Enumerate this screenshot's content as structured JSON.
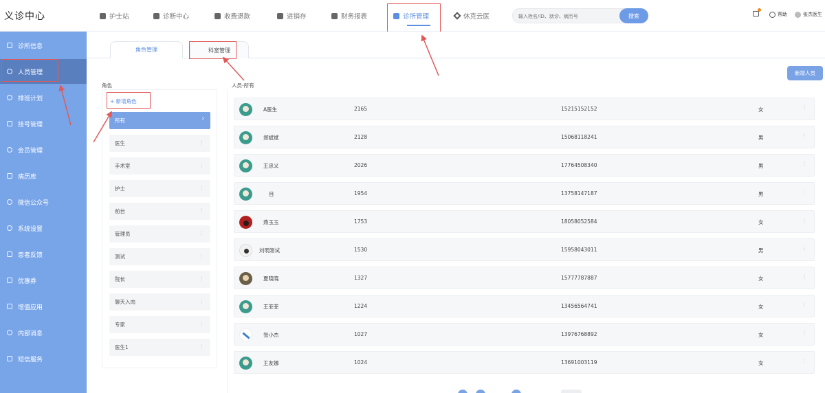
{
  "app": {
    "title": "义诊中心"
  },
  "nav": [
    {
      "label": "护士站",
      "icon": "nurse-station-icon"
    },
    {
      "label": "诊断中心",
      "icon": "diagnosis-icon"
    },
    {
      "label": "收费退款",
      "icon": "billing-icon"
    },
    {
      "label": "进销存",
      "icon": "inventory-icon"
    },
    {
      "label": "财务报表",
      "icon": "finance-report-icon"
    },
    {
      "label": "诊所管理",
      "icon": "clinic-manage-icon",
      "active": true
    },
    {
      "label": "休克云医",
      "icon": "cloud-doctor-icon"
    }
  ],
  "search": {
    "placeholder": "输入姓名/ID、就诊、病历号",
    "button": "搜索"
  },
  "header_right": {
    "messages_icon": "message-icon",
    "help": "帮助",
    "user": "张杰医生"
  },
  "sidebar": [
    {
      "label": "诊所信息",
      "icon": "clinic-info-icon"
    },
    {
      "label": "人员管理",
      "icon": "person-icon",
      "active": true
    },
    {
      "label": "排班计划",
      "icon": "schedule-icon"
    },
    {
      "label": "挂号管理",
      "icon": "register-icon"
    },
    {
      "label": "会员管理",
      "icon": "member-icon"
    },
    {
      "label": "病历库",
      "icon": "record-icon"
    },
    {
      "label": "微信公众号",
      "icon": "wechat-icon"
    },
    {
      "label": "系统设置",
      "icon": "settings-icon"
    },
    {
      "label": "患者反馈",
      "icon": "feedback-icon"
    },
    {
      "label": "优惠券",
      "icon": "coupon-icon"
    },
    {
      "label": "增值应用",
      "icon": "addon-icon"
    },
    {
      "label": "内部消息",
      "icon": "inbox-icon"
    },
    {
      "label": "短信服务",
      "icon": "sms-icon"
    }
  ],
  "tabs": [
    {
      "label": "角色管理",
      "active": true
    },
    {
      "label": "科室管理",
      "active": false
    }
  ],
  "roles": {
    "title": "角色",
    "add_label": "+ 新增角色",
    "items": [
      {
        "label": "所有",
        "active": true
      },
      {
        "label": "医生"
      },
      {
        "label": "手术室"
      },
      {
        "label": "护士"
      },
      {
        "label": "前台"
      },
      {
        "label": "管理员"
      },
      {
        "label": "测试"
      },
      {
        "label": "院长"
      },
      {
        "label": "聊天入肉"
      },
      {
        "label": "专家"
      },
      {
        "label": "医生1"
      }
    ]
  },
  "people": {
    "title": "人员-所有",
    "add_button": "新增人员",
    "rows": [
      {
        "name": "A医生",
        "id": "2165",
        "phone": "15215152152",
        "gender": "女",
        "avatar": "teal"
      },
      {
        "name": "郑斌斌",
        "id": "2128",
        "phone": "15068118241",
        "gender": "男",
        "avatar": "teal"
      },
      {
        "name": "王忠义",
        "id": "2026",
        "phone": "17764508340",
        "gender": "男",
        "avatar": "teal"
      },
      {
        "name": "目",
        "id": "1954",
        "phone": "13758147187",
        "gender": "男",
        "avatar": "teal"
      },
      {
        "name": "燕玉玉",
        "id": "1753",
        "phone": "18058052584",
        "gender": "女",
        "avatar": "red"
      },
      {
        "name": "刘明测试",
        "id": "1530",
        "phone": "15958043011",
        "gender": "男",
        "avatar": "white"
      },
      {
        "name": "夏晓晓",
        "id": "1327",
        "phone": "15777787887",
        "gender": "女",
        "avatar": "brown"
      },
      {
        "name": "王菲菲",
        "id": "1224",
        "phone": "13456564741",
        "gender": "女",
        "avatar": "teal"
      },
      {
        "name": "张小杰",
        "id": "1027",
        "phone": "13976768892",
        "gender": "女",
        "avatar": "blue"
      },
      {
        "name": "王友娜",
        "id": "1024",
        "phone": "13691003119",
        "gender": "女",
        "avatar": "teal"
      }
    ]
  },
  "colors": {
    "accent": "#5b8fe0",
    "sidebar": "#78a4e8",
    "sidebar_active": "#5a7fbf",
    "highlight": "#e05a5a"
  }
}
